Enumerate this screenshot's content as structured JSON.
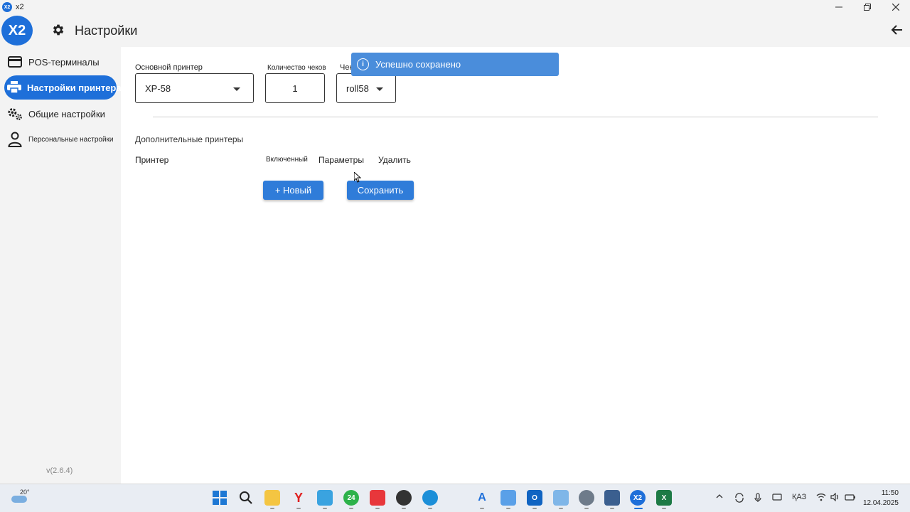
{
  "window": {
    "app_icon": "X2",
    "title": "x2",
    "controls": [
      "minimize-icon",
      "restore-icon",
      "close-icon"
    ]
  },
  "header": {
    "logo": "X2",
    "title": "Настройки",
    "back_icon": "arrow-left-icon"
  },
  "sidebar": {
    "items": [
      {
        "label": "POS-терминалы",
        "icon": "card-icon",
        "active": false
      },
      {
        "label": "Настройки принтера",
        "icon": "printer-icon",
        "active": true
      },
      {
        "label": "Общие настройки",
        "icon": "gears-icon",
        "active": false
      },
      {
        "label": "Персональные настройки",
        "icon": "person-icon",
        "active": false
      }
    ],
    "version": "v(2.6.4)"
  },
  "main": {
    "primary_printer": {
      "label": "Основной принтер",
      "value": "XP-58"
    },
    "receipt_count": {
      "label": "Количество чеков",
      "value": "1"
    },
    "receipt_type": {
      "label": "Чек",
      "value": "roll58"
    },
    "additional_title": "Дополнительные принтеры",
    "columns": {
      "printer": "Принтер",
      "enabled": "Включенный",
      "params": "Параметры",
      "delete": "Удалить"
    },
    "new_button": "+ Новый",
    "save_button": "Сохранить"
  },
  "toast": {
    "message": "Успешно сохранено",
    "icon": "info-icon"
  },
  "taskbar": {
    "temperature": "20°",
    "language": "ҚАЗ",
    "time": "11:50",
    "date": "12.04.2025",
    "apps": [
      "windows-start-icon",
      "search-icon",
      "file-explorer-icon",
      "yandex-browser-icon",
      "maps-icon",
      "calendar-24-icon",
      "anydesk-icon",
      "obs-icon",
      "edge-icon",
      "text-app-icon",
      "notepad-icon",
      "outlook-icon",
      "paint-icon",
      "settings-icon",
      "network-app-icon",
      "x2-app-icon",
      "excel-icon"
    ],
    "x2_badge": "X2",
    "calendar_badge": "24",
    "outlook_badge": "O",
    "excel_badge": "X"
  },
  "colors": {
    "accent": "#1e6fd9",
    "button": "#2f7cd9",
    "toast": "#4a8ddb",
    "background": "#f3f3f3",
    "panel": "#ffffff"
  }
}
